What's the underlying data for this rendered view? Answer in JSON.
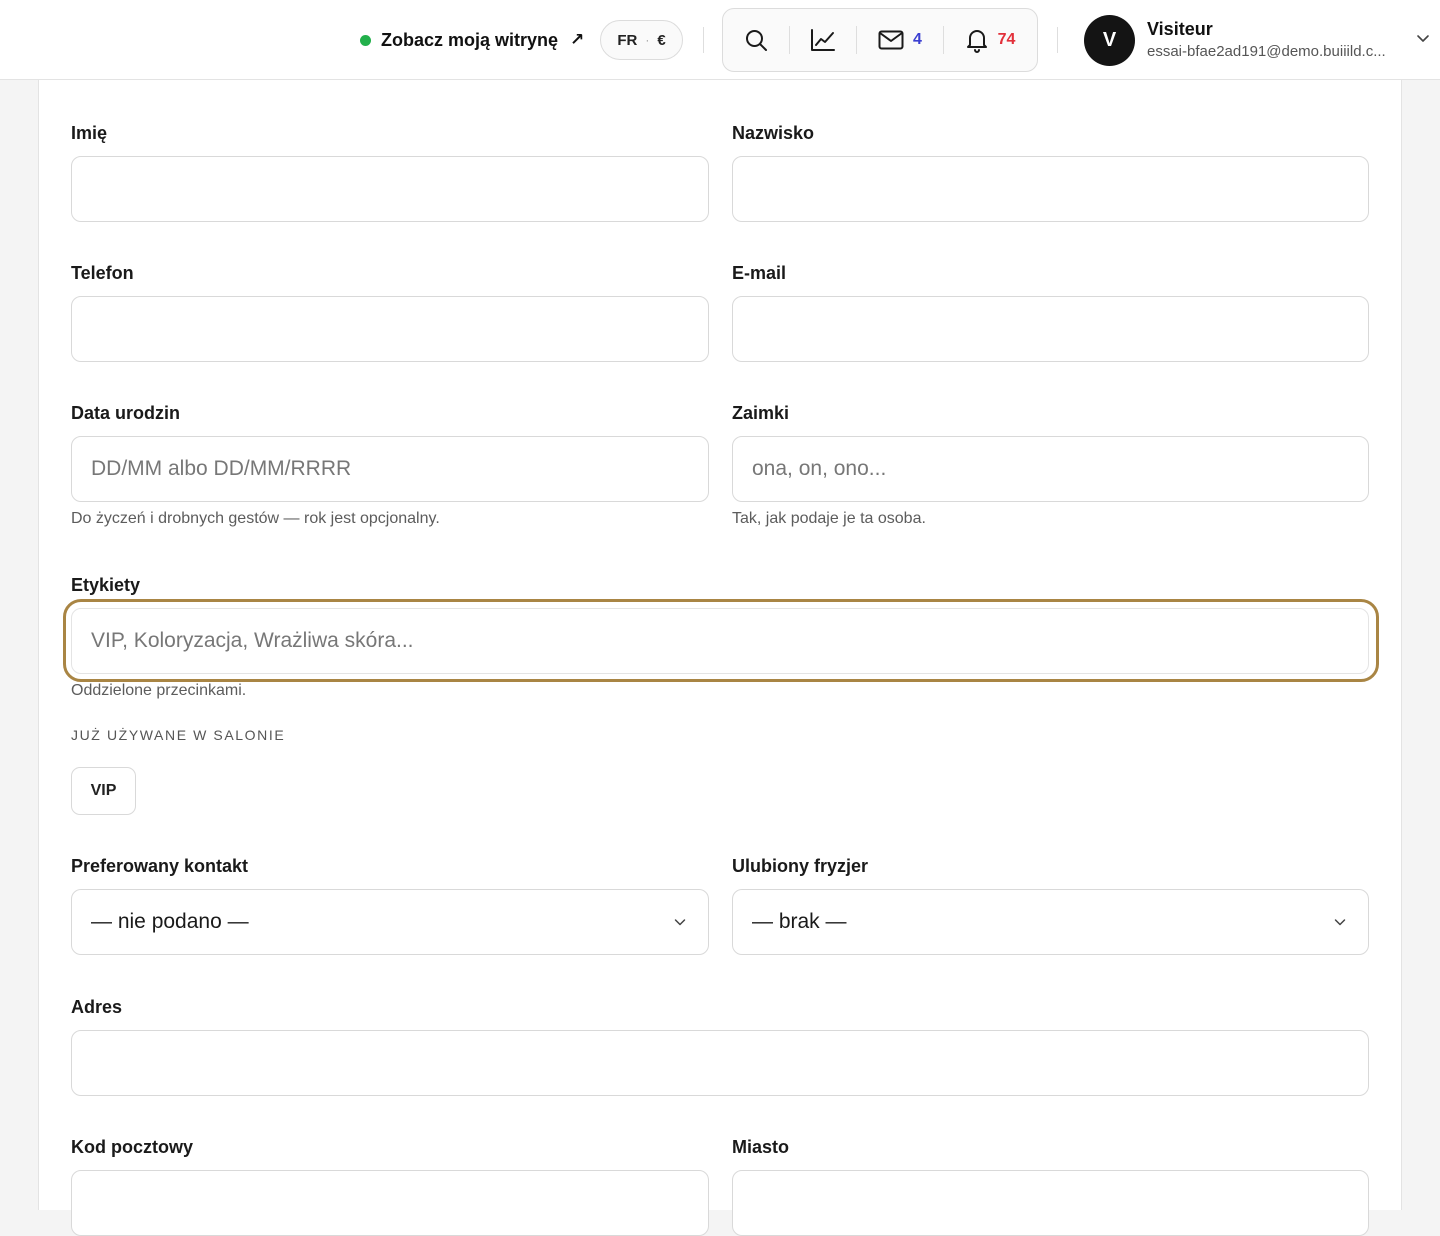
{
  "header": {
    "site_link_label": "Zobacz moją witrynę",
    "site_link_arrow": "↗",
    "locale": "FR",
    "locale_separator": "·",
    "currency": "€",
    "messages_count": "4",
    "notifications_count": "74",
    "user": {
      "initial": "V",
      "name": "Visiteur",
      "email": "essai-bfae2ad191@demo.buiiild.c..."
    },
    "icons": [
      "search-icon",
      "chart-icon",
      "mail-icon",
      "bell-icon",
      "chevron-down-icon"
    ],
    "colors": {
      "status_green": "#22b04b",
      "badge_blue": "#3b3fd1",
      "badge_red": "#e2303a",
      "focus_ring": "#a98544"
    }
  },
  "form": {
    "first_name": {
      "label": "Imię",
      "value": ""
    },
    "last_name": {
      "label": "Nazwisko",
      "value": ""
    },
    "phone": {
      "label": "Telefon",
      "value": ""
    },
    "email": {
      "label": "E-mail",
      "value": ""
    },
    "birthday": {
      "label": "Data urodzin",
      "placeholder": "DD/MM albo DD/MM/RRRR",
      "help": "Do życzeń i drobnych gestów — rok jest opcjonalny."
    },
    "pronouns": {
      "label": "Zaimki",
      "placeholder": "ona, on, ono...",
      "help": "Tak, jak podaje je ta osoba."
    },
    "tags": {
      "label": "Etykiety",
      "placeholder": "VIP, Koloryzacja, Wrażliwa skóra...",
      "help": "Oddzielone przecinkami.",
      "existing_heading": "JUŻ UŻYWANE W SALONIE",
      "existing": [
        "VIP"
      ]
    },
    "preferred_contact": {
      "label": "Preferowany kontakt",
      "selected": "— nie podano —"
    },
    "favorite_stylist": {
      "label": "Ulubiony fryzjer",
      "selected": "— brak —"
    },
    "address": {
      "label": "Adres",
      "value": ""
    },
    "postal_code": {
      "label": "Kod pocztowy",
      "value": ""
    },
    "city": {
      "label": "Miasto",
      "value": ""
    }
  }
}
